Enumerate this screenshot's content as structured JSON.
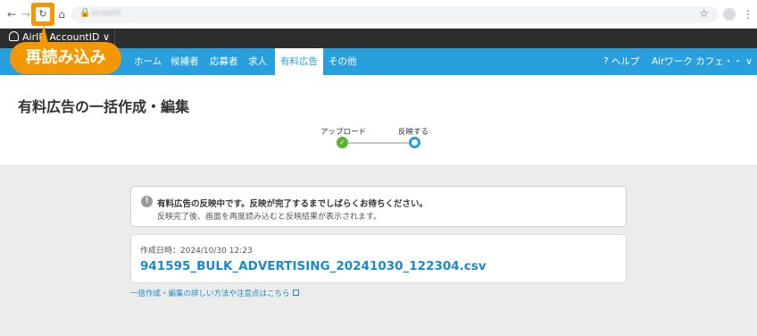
{
  "browser": {
    "back_icon": "arrow-left-icon",
    "forward_icon": "arrow-right-icon",
    "reload_icon": "reload-icon",
    "home_icon": "home-icon",
    "url": "airwork"
  },
  "account": {
    "label": "AirID AccountID ∨"
  },
  "callout": {
    "label": "再読み込み",
    "color": "#f39800"
  },
  "nav": {
    "items": [
      {
        "label": "ホーム"
      },
      {
        "label": "候補者"
      },
      {
        "label": "応募者"
      },
      {
        "label": "求人"
      },
      {
        "label": "有料広告",
        "active": true
      },
      {
        "label": "その他"
      }
    ],
    "help_label": "? ヘルプ",
    "company_label": "Airワーク カフェ・・ ∨",
    "accent": "#27a0dd"
  },
  "page": {
    "title": "有料広告の一括作成・編集",
    "steps": [
      {
        "label": "アップロード",
        "status": "done"
      },
      {
        "label": "反映する",
        "status": "current"
      }
    ],
    "info": {
      "title": "有料広告の反映中です。反映が完了するまでしばらくお待ちください。",
      "sub": "反映完了後、画面を再度読み込むと反映結果が表示されます。"
    },
    "file": {
      "date_label": "作成日時：2024/10/30 12:23",
      "filename": "941595_BULK_ADVERTISING_20241030_122304.csv"
    },
    "help_link": "一括作成・編集の詳しい方法や注意点はこちら"
  }
}
